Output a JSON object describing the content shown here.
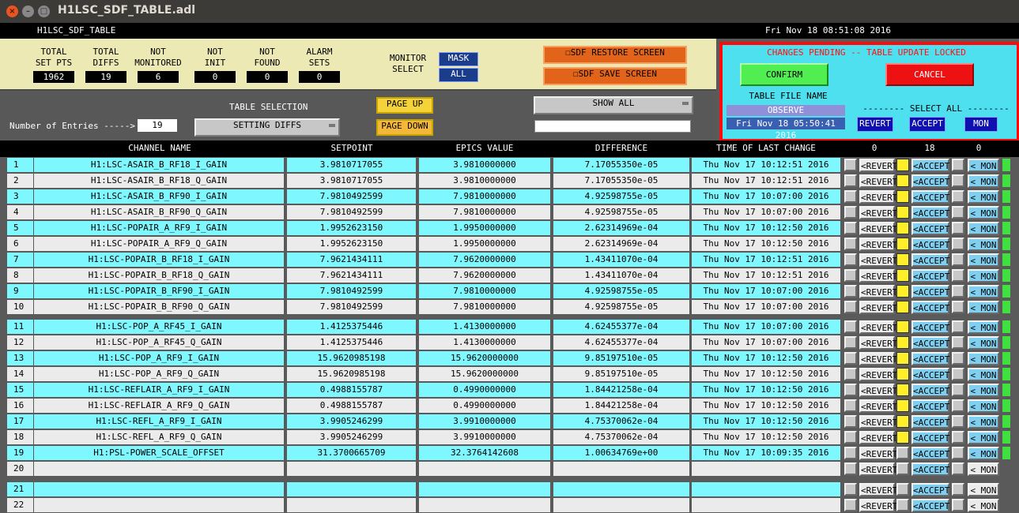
{
  "window": {
    "title": "H1LSC_SDF_TABLE.adl"
  },
  "header": {
    "screen_name": "H1LSC_SDF_TABLE",
    "datetime": "Fri Nov 18 08:51:08 2016"
  },
  "stats": [
    {
      "label1": "TOTAL",
      "label2": "SET PTS",
      "value": "1962"
    },
    {
      "label1": "TOTAL",
      "label2": "DIFFS",
      "value": "19"
    },
    {
      "label1": "NOT",
      "label2": "MONITORED",
      "value": "6"
    },
    {
      "label1": "NOT",
      "label2": "INIT",
      "value": "0"
    },
    {
      "label1": "NOT",
      "label2": "FOUND",
      "value": "0"
    },
    {
      "label1": "ALARM",
      "label2": "SETS",
      "value": "0"
    }
  ],
  "monitor": {
    "label1": "MONITOR",
    "label2": "SELECT",
    "mask": "MASK",
    "all": "ALL"
  },
  "buttons": {
    "restore": "☐SDF RESTORE SCREEN",
    "save": "☐SDF SAVE SCREEN",
    "page_up": "PAGE UP",
    "page_down": "PAGE DOWN",
    "show_all": "SHOW ALL",
    "setting_diffs": "SETTING DIFFS"
  },
  "table_selection": {
    "label": "TABLE SELECTION",
    "entries_label": "Number of Entries ----->",
    "entries_value": "19",
    "filter_value": ""
  },
  "pending": {
    "message": "CHANGES PENDING -- TABLE UPDATE LOCKED",
    "confirm": "CONFIRM",
    "cancel": "CANCEL",
    "file_label": "TABLE FILE NAME",
    "file_name": "OBSERVE",
    "file_time": "Fri Nov 18 05:50:41 2016",
    "select_all": "-------- SELECT ALL --------",
    "revert": "REVERT",
    "accept": "ACCEPT",
    "mon": "MON"
  },
  "columns": {
    "channel": "CHANNEL NAME",
    "setpoint": "SETPOINT",
    "epics": "EPICS VALUE",
    "difference": "DIFFERENCE",
    "time": "TIME OF LAST CHANGE",
    "count_revert": "0",
    "count_accept": "18",
    "count_mon": "0"
  },
  "row_buttons": {
    "revert": "<REVERT",
    "accept": "<ACCEPT",
    "mon": "< MON"
  },
  "rows": [
    {
      "n": "1",
      "name": "H1:LSC-ASAIR_B_RF18_I_GAIN",
      "setpoint": "3.9810717055",
      "epics": "3.9810000000",
      "diff": "7.17055350e-05",
      "time": "Thu Nov 17 10:12:51 2016",
      "accepted": true
    },
    {
      "n": "2",
      "name": "H1:LSC-ASAIR_B_RF18_Q_GAIN",
      "setpoint": "3.9810717055",
      "epics": "3.9810000000",
      "diff": "7.17055350e-05",
      "time": "Thu Nov 17 10:12:51 2016",
      "accepted": true
    },
    {
      "n": "3",
      "name": "H1:LSC-ASAIR_B_RF90_I_GAIN",
      "setpoint": "7.9810492599",
      "epics": "7.9810000000",
      "diff": "4.92598755e-05",
      "time": "Thu Nov 17 10:07:00 2016",
      "accepted": true
    },
    {
      "n": "4",
      "name": "H1:LSC-ASAIR_B_RF90_Q_GAIN",
      "setpoint": "7.9810492599",
      "epics": "7.9810000000",
      "diff": "4.92598755e-05",
      "time": "Thu Nov 17 10:07:00 2016",
      "accepted": true
    },
    {
      "n": "5",
      "name": "H1:LSC-POPAIR_A_RF9_I_GAIN",
      "setpoint": "1.9952623150",
      "epics": "1.9950000000",
      "diff": "2.62314969e-04",
      "time": "Thu Nov 17 10:12:50 2016",
      "accepted": true
    },
    {
      "n": "6",
      "name": "H1:LSC-POPAIR_A_RF9_Q_GAIN",
      "setpoint": "1.9952623150",
      "epics": "1.9950000000",
      "diff": "2.62314969e-04",
      "time": "Thu Nov 17 10:12:50 2016",
      "accepted": true
    },
    {
      "n": "7",
      "name": "H1:LSC-POPAIR_B_RF18_I_GAIN",
      "setpoint": "7.9621434111",
      "epics": "7.9620000000",
      "diff": "1.43411070e-04",
      "time": "Thu Nov 17 10:12:51 2016",
      "accepted": true
    },
    {
      "n": "8",
      "name": "H1:LSC-POPAIR_B_RF18_Q_GAIN",
      "setpoint": "7.9621434111",
      "epics": "7.9620000000",
      "diff": "1.43411070e-04",
      "time": "Thu Nov 17 10:12:51 2016",
      "accepted": true
    },
    {
      "n": "9",
      "name": "H1:LSC-POPAIR_B_RF90_I_GAIN",
      "setpoint": "7.9810492599",
      "epics": "7.9810000000",
      "diff": "4.92598755e-05",
      "time": "Thu Nov 17 10:07:00 2016",
      "accepted": true
    },
    {
      "n": "10",
      "name": "H1:LSC-POPAIR_B_RF90_Q_GAIN",
      "setpoint": "7.9810492599",
      "epics": "7.9810000000",
      "diff": "4.92598755e-05",
      "time": "Thu Nov 17 10:07:00 2016",
      "accepted": true
    },
    {
      "n": "11",
      "name": "H1:LSC-POP_A_RF45_I_GAIN",
      "setpoint": "1.4125375446",
      "epics": "1.4130000000",
      "diff": "4.62455377e-04",
      "time": "Thu Nov 17 10:07:00 2016",
      "accepted": true
    },
    {
      "n": "12",
      "name": "H1:LSC-POP_A_RF45_Q_GAIN",
      "setpoint": "1.4125375446",
      "epics": "1.4130000000",
      "diff": "4.62455377e-04",
      "time": "Thu Nov 17 10:07:00 2016",
      "accepted": true
    },
    {
      "n": "13",
      "name": "H1:LSC-POP_A_RF9_I_GAIN",
      "setpoint": "15.9620985198",
      "epics": "15.9620000000",
      "diff": "9.85197510e-05",
      "time": "Thu Nov 17 10:12:50 2016",
      "accepted": true
    },
    {
      "n": "14",
      "name": "H1:LSC-POP_A_RF9_Q_GAIN",
      "setpoint": "15.9620985198",
      "epics": "15.9620000000",
      "diff": "9.85197510e-05",
      "time": "Thu Nov 17 10:12:50 2016",
      "accepted": true
    },
    {
      "n": "15",
      "name": "H1:LSC-REFLAIR_A_RF9_I_GAIN",
      "setpoint": "0.4988155787",
      "epics": "0.4990000000",
      "diff": "1.84421258e-04",
      "time": "Thu Nov 17 10:12:50 2016",
      "accepted": true
    },
    {
      "n": "16",
      "name": "H1:LSC-REFLAIR_A_RF9_Q_GAIN",
      "setpoint": "0.4988155787",
      "epics": "0.4990000000",
      "diff": "1.84421258e-04",
      "time": "Thu Nov 17 10:12:50 2016",
      "accepted": true
    },
    {
      "n": "17",
      "name": "H1:LSC-REFL_A_RF9_I_GAIN",
      "setpoint": "3.9905246299",
      "epics": "3.9910000000",
      "diff": "4.75370062e-04",
      "time": "Thu Nov 17 10:12:50 2016",
      "accepted": true
    },
    {
      "n": "18",
      "name": "H1:LSC-REFL_A_RF9_Q_GAIN",
      "setpoint": "3.9905246299",
      "epics": "3.9910000000",
      "diff": "4.75370062e-04",
      "time": "Thu Nov 17 10:12:50 2016",
      "accepted": true
    },
    {
      "n": "19",
      "name": "H1:PSL-POWER_SCALE_OFFSET",
      "setpoint": "31.3700665709",
      "epics": "32.3764142608",
      "diff": "1.00634769e+00",
      "time": "Thu Nov 17 10:09:35 2016",
      "accepted": false
    },
    {
      "n": "20",
      "name": "",
      "setpoint": "",
      "epics": "",
      "diff": "",
      "time": "",
      "accepted": false
    },
    {
      "n": "21",
      "name": "",
      "setpoint": "",
      "epics": "",
      "diff": "",
      "time": "",
      "accepted": false
    },
    {
      "n": "22",
      "name": "",
      "setpoint": "",
      "epics": "",
      "diff": "",
      "time": "",
      "accepted": false
    }
  ],
  "colors": {
    "cyan": "#7ff7ff",
    "light_gray": "#ebebeb",
    "accept_blue": "#7fd0f0",
    "revert_gray": "#ebebeb",
    "warn_red": "#ff0a0a",
    "confirm_green": "#50ee50",
    "cancel_red": "#ee1111",
    "selected_yellow": "#ffee2a",
    "green_indicator": "#40e040"
  }
}
